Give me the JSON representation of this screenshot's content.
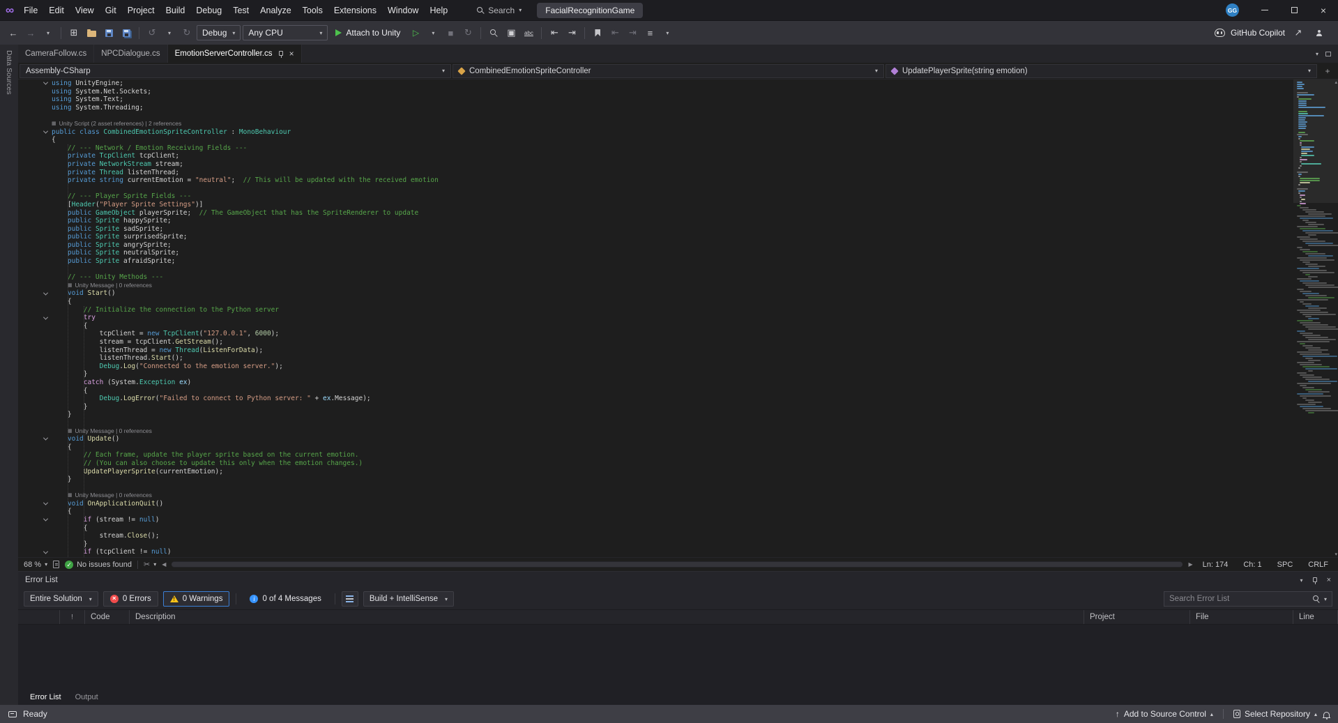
{
  "titlebar": {
    "search_label": "Search",
    "solution_name": "FacialRecognitionGame",
    "account_initials": "GG"
  },
  "menubar": {
    "items": [
      "File",
      "Edit",
      "View",
      "Git",
      "Project",
      "Build",
      "Debug",
      "Test",
      "Analyze",
      "Tools",
      "Extensions",
      "Window",
      "Help"
    ]
  },
  "toolbar": {
    "configuration": "Debug",
    "platform": "Any CPU",
    "attach_label": "Attach to Unity",
    "copilot_label": "GitHub Copilot"
  },
  "side_strip": {
    "label": "Data Sources"
  },
  "tabs": [
    {
      "label": "CameraFollow.cs",
      "active": false
    },
    {
      "label": "NPCDialogue.cs",
      "active": false
    },
    {
      "label": "EmotionServerController.cs",
      "active": true
    }
  ],
  "navbar": {
    "project": "Assembly-CSharp",
    "type_name": "CombinedEmotionSpriteController",
    "member": "UpdatePlayerSprite(string emotion)"
  },
  "editor": {
    "status": {
      "zoom": "68 %",
      "health": "No issues found",
      "line": "Ln: 174",
      "column": "Ch: 1",
      "spaces": "SPC",
      "line_ending": "CRLF"
    },
    "lines": [
      {
        "fold": true,
        "tok": [
          [
            "k",
            "using"
          ],
          [
            "p",
            " UnityEngine;"
          ]
        ]
      },
      {
        "tok": [
          [
            "k",
            "using"
          ],
          [
            "p",
            " System.Net.Sockets;"
          ]
        ]
      },
      {
        "tok": [
          [
            "k",
            "using"
          ],
          [
            "p",
            " System.Text;"
          ]
        ]
      },
      {
        "tok": [
          [
            "k",
            "using"
          ],
          [
            "p",
            " System.Threading;"
          ]
        ]
      },
      {
        "tok": []
      },
      {
        "cl": "Unity Script (2 asset references) | 2 references",
        "ind": 0
      },
      {
        "fold": true,
        "tok": [
          [
            "k",
            "public"
          ],
          [
            "p",
            " "
          ],
          [
            "k",
            "class"
          ],
          [
            "p",
            " "
          ],
          [
            "t",
            "CombinedEmotionSpriteController"
          ],
          [
            "p",
            " : "
          ],
          [
            "t",
            "MonoBehaviour"
          ]
        ]
      },
      {
        "tok": [
          [
            "p",
            "{"
          ]
        ]
      },
      {
        "tok": [
          [
            "p",
            "    "
          ],
          [
            "c",
            "// --- Network / Emotion Receiving Fields ---"
          ]
        ]
      },
      {
        "tok": [
          [
            "p",
            "    "
          ],
          [
            "k",
            "private"
          ],
          [
            "p",
            " "
          ],
          [
            "t",
            "TcpClient"
          ],
          [
            "p",
            " tcpClient;"
          ]
        ]
      },
      {
        "tok": [
          [
            "p",
            "    "
          ],
          [
            "k",
            "private"
          ],
          [
            "p",
            " "
          ],
          [
            "t",
            "NetworkStream"
          ],
          [
            "p",
            " stream;"
          ]
        ]
      },
      {
        "tok": [
          [
            "p",
            "    "
          ],
          [
            "k",
            "private"
          ],
          [
            "p",
            " "
          ],
          [
            "t",
            "Thread"
          ],
          [
            "p",
            " listenThread;"
          ]
        ]
      },
      {
        "tok": [
          [
            "p",
            "    "
          ],
          [
            "k",
            "private"
          ],
          [
            "p",
            " "
          ],
          [
            "k",
            "string"
          ],
          [
            "p",
            " currentEmotion = "
          ],
          [
            "s",
            "\"neutral\""
          ],
          [
            "p",
            ";  "
          ],
          [
            "c",
            "// This will be updated with the received emotion"
          ]
        ]
      },
      {
        "tok": []
      },
      {
        "tok": [
          [
            "p",
            "    "
          ],
          [
            "c",
            "// --- Player Sprite Fields ---"
          ]
        ]
      },
      {
        "tok": [
          [
            "p",
            "    ["
          ],
          [
            "t",
            "Header"
          ],
          [
            "p",
            "("
          ],
          [
            "s",
            "\"Player Sprite Settings\""
          ],
          [
            "p",
            ")]"
          ]
        ]
      },
      {
        "tok": [
          [
            "p",
            "    "
          ],
          [
            "k",
            "public"
          ],
          [
            "p",
            " "
          ],
          [
            "t",
            "GameObject"
          ],
          [
            "p",
            " playerSprite;  "
          ],
          [
            "c",
            "// The GameObject that has the SpriteRenderer to update"
          ]
        ]
      },
      {
        "tok": [
          [
            "p",
            "    "
          ],
          [
            "k",
            "public"
          ],
          [
            "p",
            " "
          ],
          [
            "t",
            "Sprite"
          ],
          [
            "p",
            " happySprite;"
          ]
        ]
      },
      {
        "tok": [
          [
            "p",
            "    "
          ],
          [
            "k",
            "public"
          ],
          [
            "p",
            " "
          ],
          [
            "t",
            "Sprite"
          ],
          [
            "p",
            " sadSprite;"
          ]
        ]
      },
      {
        "tok": [
          [
            "p",
            "    "
          ],
          [
            "k",
            "public"
          ],
          [
            "p",
            " "
          ],
          [
            "t",
            "Sprite"
          ],
          [
            "p",
            " surprisedSprite;"
          ]
        ]
      },
      {
        "tok": [
          [
            "p",
            "    "
          ],
          [
            "k",
            "public"
          ],
          [
            "p",
            " "
          ],
          [
            "t",
            "Sprite"
          ],
          [
            "p",
            " angrySprite;"
          ]
        ]
      },
      {
        "tok": [
          [
            "p",
            "    "
          ],
          [
            "k",
            "public"
          ],
          [
            "p",
            " "
          ],
          [
            "t",
            "Sprite"
          ],
          [
            "p",
            " neutralSprite;"
          ]
        ]
      },
      {
        "tok": [
          [
            "p",
            "    "
          ],
          [
            "k",
            "public"
          ],
          [
            "p",
            " "
          ],
          [
            "t",
            "Sprite"
          ],
          [
            "p",
            " afraidSprite;"
          ]
        ]
      },
      {
        "tok": []
      },
      {
        "tok": [
          [
            "p",
            "    "
          ],
          [
            "c",
            "// --- Unity Methods ---"
          ]
        ]
      },
      {
        "cl": "Unity Message | 0 references",
        "ind": 4
      },
      {
        "fold": true,
        "tok": [
          [
            "p",
            "    "
          ],
          [
            "k",
            "void"
          ],
          [
            "p",
            " "
          ],
          [
            "m",
            "Start"
          ],
          [
            "p",
            "()"
          ]
        ]
      },
      {
        "tok": [
          [
            "p",
            "    {"
          ]
        ]
      },
      {
        "tok": [
          [
            "p",
            "        "
          ],
          [
            "c",
            "// Initialize the connection to the Python server"
          ]
        ]
      },
      {
        "fold": true,
        "tok": [
          [
            "p",
            "        "
          ],
          [
            "cf",
            "try"
          ]
        ]
      },
      {
        "tok": [
          [
            "p",
            "        {"
          ]
        ]
      },
      {
        "tok": [
          [
            "p",
            "            tcpClient = "
          ],
          [
            "k",
            "new"
          ],
          [
            "p",
            " "
          ],
          [
            "t",
            "TcpClient"
          ],
          [
            "p",
            "("
          ],
          [
            "s",
            "\"127.0.0.1\""
          ],
          [
            "p",
            ", "
          ],
          [
            "n",
            "6000"
          ],
          [
            "p",
            ");"
          ]
        ]
      },
      {
        "tok": [
          [
            "p",
            "            stream = tcpClient."
          ],
          [
            "m",
            "GetStream"
          ],
          [
            "p",
            "();"
          ]
        ]
      },
      {
        "tok": [
          [
            "p",
            "            listenThread = "
          ],
          [
            "k",
            "new"
          ],
          [
            "p",
            " "
          ],
          [
            "t",
            "Thread"
          ],
          [
            "p",
            "("
          ],
          [
            "m",
            "ListenForData"
          ],
          [
            "p",
            ");"
          ]
        ]
      },
      {
        "tok": [
          [
            "p",
            "            listenThread."
          ],
          [
            "m",
            "Start"
          ],
          [
            "p",
            "();"
          ]
        ]
      },
      {
        "tok": [
          [
            "p",
            "            "
          ],
          [
            "t",
            "Debug"
          ],
          [
            "p",
            "."
          ],
          [
            "m",
            "Log"
          ],
          [
            "p",
            "("
          ],
          [
            "s",
            "\"Connected to the emotion server.\""
          ],
          [
            "p",
            ");"
          ]
        ]
      },
      {
        "tok": [
          [
            "p",
            "        }"
          ]
        ]
      },
      {
        "tok": [
          [
            "p",
            "        "
          ],
          [
            "cf",
            "catch"
          ],
          [
            "p",
            " (System."
          ],
          [
            "t",
            "Exception"
          ],
          [
            "p",
            " "
          ],
          [
            "lb",
            "ex"
          ],
          [
            "p",
            ")"
          ]
        ]
      },
      {
        "tok": [
          [
            "p",
            "        {"
          ]
        ]
      },
      {
        "tok": [
          [
            "p",
            "            "
          ],
          [
            "t",
            "Debug"
          ],
          [
            "p",
            "."
          ],
          [
            "m",
            "LogError"
          ],
          [
            "p",
            "("
          ],
          [
            "s",
            "\"Failed to connect to Python server: \""
          ],
          [
            "p",
            " + "
          ],
          [
            "lb",
            "ex"
          ],
          [
            "p",
            ".Message);"
          ]
        ]
      },
      {
        "tok": [
          [
            "p",
            "        }"
          ]
        ]
      },
      {
        "tok": [
          [
            "p",
            "    }"
          ]
        ]
      },
      {
        "tok": []
      },
      {
        "cl": "Unity Message | 0 references",
        "ind": 4
      },
      {
        "fold": true,
        "tok": [
          [
            "p",
            "    "
          ],
          [
            "k",
            "void"
          ],
          [
            "p",
            " "
          ],
          [
            "m",
            "Update"
          ],
          [
            "p",
            "()"
          ]
        ]
      },
      {
        "tok": [
          [
            "p",
            "    {"
          ]
        ]
      },
      {
        "tok": [
          [
            "p",
            "        "
          ],
          [
            "c",
            "// Each frame, update the player sprite based on the current emotion."
          ]
        ]
      },
      {
        "tok": [
          [
            "p",
            "        "
          ],
          [
            "c",
            "// (You can also choose to update this only when the emotion changes.)"
          ]
        ]
      },
      {
        "tok": [
          [
            "p",
            "        "
          ],
          [
            "m",
            "UpdatePlayerSprite"
          ],
          [
            "p",
            "(currentEmotion);"
          ]
        ]
      },
      {
        "tok": [
          [
            "p",
            "    }"
          ]
        ]
      },
      {
        "tok": []
      },
      {
        "cl": "Unity Message | 0 references",
        "ind": 4
      },
      {
        "fold": true,
        "tok": [
          [
            "p",
            "    "
          ],
          [
            "k",
            "void"
          ],
          [
            "p",
            " "
          ],
          [
            "m",
            "OnApplicationQuit"
          ],
          [
            "p",
            "()"
          ]
        ]
      },
      {
        "tok": [
          [
            "p",
            "    {"
          ]
        ]
      },
      {
        "fold": true,
        "tok": [
          [
            "p",
            "        "
          ],
          [
            "cf",
            "if"
          ],
          [
            "p",
            " (stream != "
          ],
          [
            "k",
            "null"
          ],
          [
            "p",
            ")"
          ]
        ]
      },
      {
        "tok": [
          [
            "p",
            "        {"
          ]
        ]
      },
      {
        "tok": [
          [
            "p",
            "            stream."
          ],
          [
            "m",
            "Close"
          ],
          [
            "p",
            "();"
          ]
        ]
      },
      {
        "tok": [
          [
            "p",
            "        }"
          ]
        ]
      },
      {
        "fold": true,
        "tok": [
          [
            "p",
            "        "
          ],
          [
            "cf",
            "if"
          ],
          [
            "p",
            " (tcpClient != "
          ],
          [
            "k",
            "null"
          ],
          [
            "p",
            ")"
          ]
        ]
      }
    ]
  },
  "error_list": {
    "title": "Error List",
    "scope": "Entire Solution",
    "errors_label": "0 Errors",
    "warnings_label": "0 Warnings",
    "messages_label": "0 of 4 Messages",
    "filter_combo": "Build + IntelliSense",
    "search_placeholder": "Search Error List",
    "columns": [
      "Code",
      "Description",
      "Project",
      "File",
      "Line"
    ]
  },
  "panel_tabs": [
    {
      "label": "Error List",
      "active": true
    },
    {
      "label": "Output",
      "active": false
    }
  ],
  "statusbar": {
    "ready": "Ready",
    "add_to_source_control": "Add to Source Control",
    "select_repository": "Select Repository"
  }
}
